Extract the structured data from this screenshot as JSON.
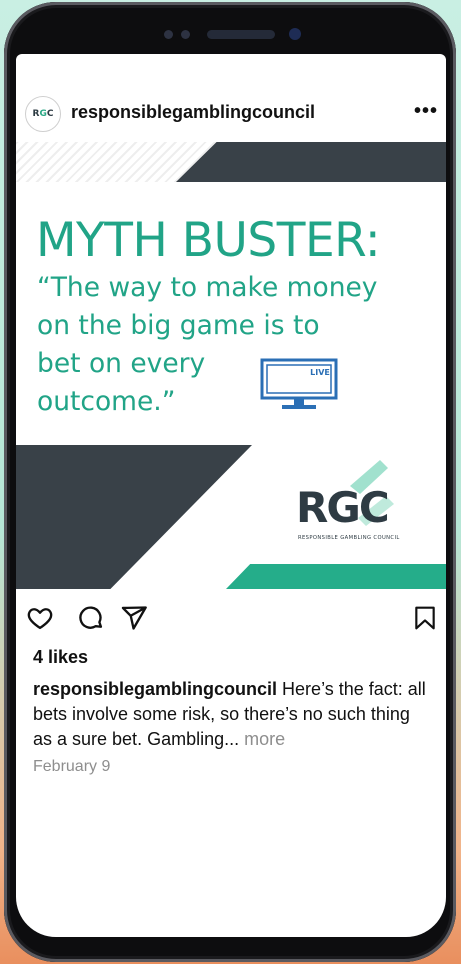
{
  "account": {
    "username": "responsiblegamblingcouncil",
    "avatar_logo": "RGC",
    "avatar_icon": "rgc-avatar-icon"
  },
  "post": {
    "headline": "MYTH BUSTER:",
    "quote": "“The way to make money\non the big game is to\nbet on every\noutcome.”",
    "tv_badge": "LIVE",
    "logo_text": "RGC",
    "logo_subtitle": "RESPONSIBLE GAMBLING COUNCIL",
    "colors": {
      "accent": "#21a487",
      "dark": "#394148",
      "band": "#25ad8a"
    }
  },
  "actions": {
    "like_icon": "heart-icon",
    "comment_icon": "comment-icon",
    "share_icon": "send-icon",
    "save_icon": "bookmark-icon"
  },
  "likes": "4 likes",
  "caption": {
    "username": "responsiblegamblingcouncil",
    "text": " Here’s the fact: all bets involve some risk, so there’s no such thing as a sure bet. Gambling...",
    "more": "more"
  },
  "date": "February 9"
}
